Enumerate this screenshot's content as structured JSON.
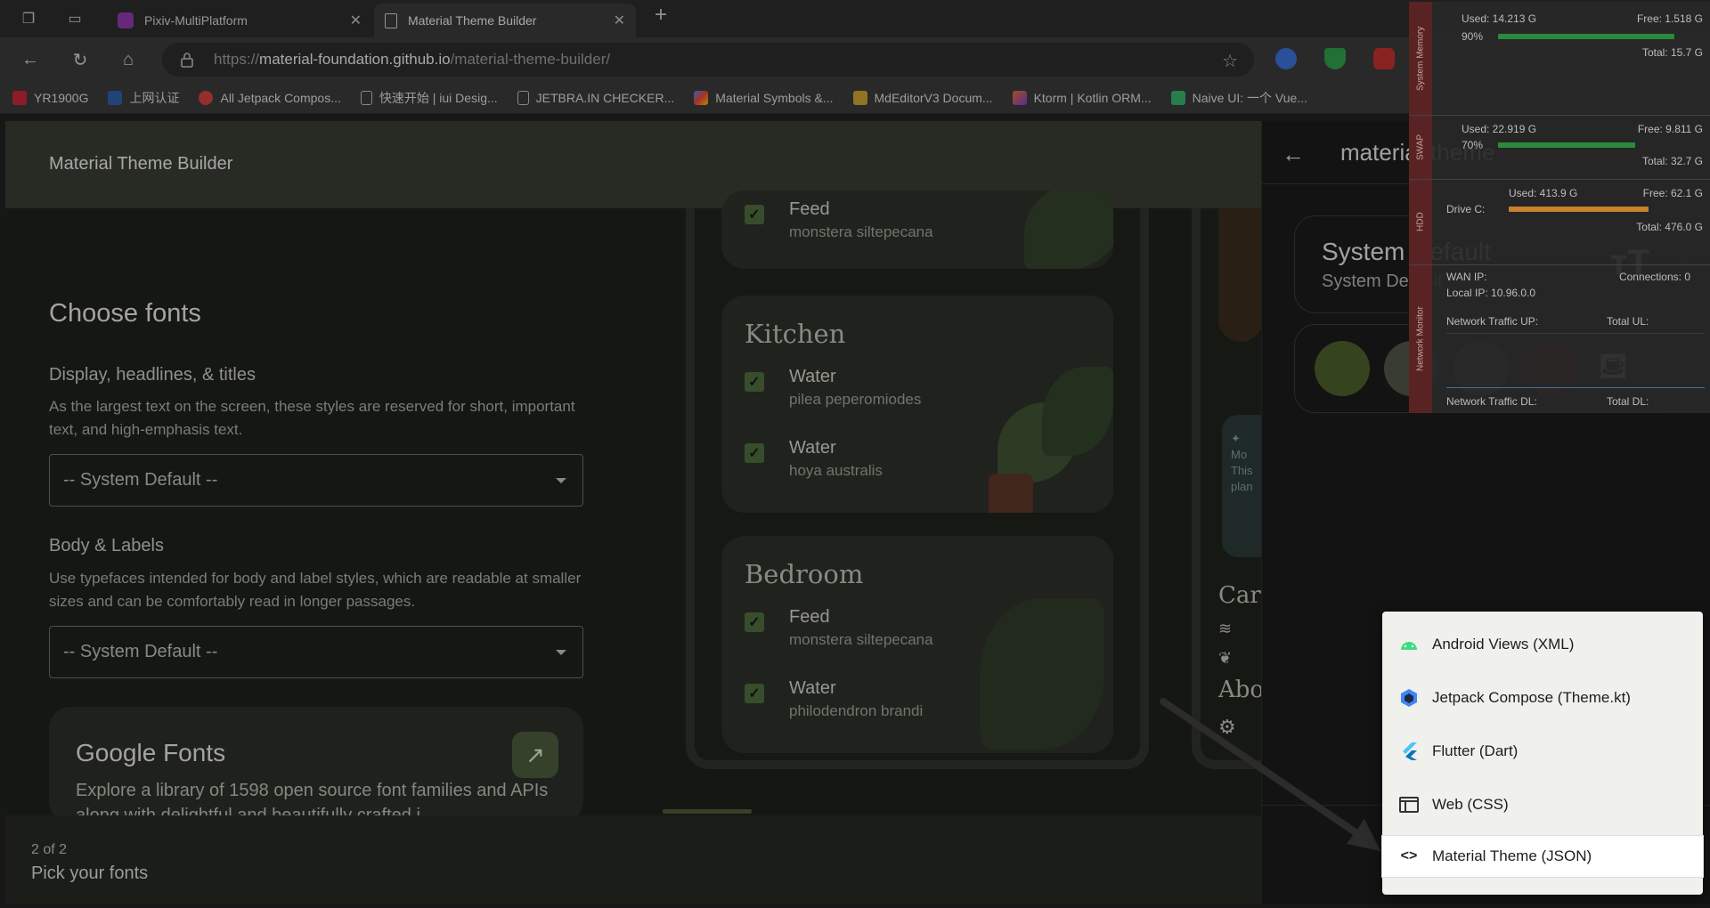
{
  "browser": {
    "tabs": [
      {
        "title": "Pixiv-MultiPlatform",
        "favicon_color": "#8e3aa8"
      },
      {
        "title": "Material Theme Builder",
        "active": true
      }
    ],
    "url_prefix": "https://",
    "url_host": "material-foundation.github.io",
    "url_path": "/material-theme-builder/",
    "bookmarks": [
      {
        "label": "YR1900G",
        "icon_color": "#c7283a"
      },
      {
        "label": "上网认证",
        "icon_color": "#2f5fa8"
      },
      {
        "label": "All Jetpack Compos...",
        "icon_color": "#d24040"
      },
      {
        "label": "快速开始 | iui Desig...",
        "icon_color": "#aaaaaa"
      },
      {
        "label": "JETBRA.IN CHECKER...",
        "icon_color": "#aaaaaa"
      },
      {
        "label": "Material Symbols &...",
        "icon_color": "#4285f4"
      },
      {
        "label": "MdEditorV3 Docum...",
        "icon_color": "#c9a030"
      },
      {
        "label": "Ktorm | Kotlin ORM...",
        "icon_color": "#e07020"
      },
      {
        "label": "Naive UI: 一个 Vue...",
        "icon_color": "#36ad6a"
      }
    ]
  },
  "app": {
    "title": "Material Theme Builder",
    "heading": "Choose fonts",
    "display_section": {
      "title": "Display, headlines, & titles",
      "description": "As the largest text on the screen, these styles are reserved for short, important text, and high-emphasis text.",
      "select_value": "-- System Default --"
    },
    "body_section": {
      "title": "Body & Labels",
      "description": "Use typefaces intended for body and label styles, which are readable at smaller sizes and can be comfortably read in longer passages.",
      "select_value": "-- System Default --"
    },
    "google_fonts": {
      "title": "Google Fonts",
      "description": "Explore a library of 1598 open source font families and APIs along with delightful and beautifully crafted i..."
    },
    "stepper": {
      "count": "2 of 2",
      "label": "Pick your fonts"
    }
  },
  "preview": {
    "top_task": {
      "name": "Feed",
      "plant": "monstera siltepecana"
    },
    "rooms": [
      {
        "name": "Kitchen",
        "tasks": [
          {
            "name": "Water",
            "plant": "pilea peperomiodes"
          },
          {
            "name": "Water",
            "plant": "hoya australis"
          }
        ]
      },
      {
        "name": "Bedroom",
        "tasks": [
          {
            "name": "Feed",
            "plant": "monstera siltepecana"
          },
          {
            "name": "Water",
            "plant": "philodendron brandi"
          }
        ]
      }
    ],
    "side_texts": {
      "mo": "Mo",
      "this": "This",
      "plan": "plan",
      "car": "Car",
      "abo": "Abo"
    }
  },
  "export_panel": {
    "title": "material-theme",
    "font_card": {
      "title": "System Default",
      "subtitle": "System Default"
    },
    "swatches": [
      "#4a5e2a",
      "#505447",
      "#3b4a3e",
      "#6b1f1f",
      "#303030"
    ],
    "menu": [
      {
        "label": "Android Views (XML)",
        "icon": "android-icon"
      },
      {
        "label": "Jetpack Compose (Theme.kt)",
        "icon": "compose-icon"
      },
      {
        "label": "Flutter (Dart)",
        "icon": "flutter-icon"
      },
      {
        "label": "Web (CSS)",
        "icon": "web-icon"
      },
      {
        "label": "Material Theme (JSON)",
        "icon": "code-icon",
        "highlighted": true
      }
    ]
  },
  "system_monitor": {
    "memory": {
      "used": "Used: 14.213 G",
      "free": "Free: 1.518 G",
      "percent": "90%",
      "total": "Total: 15.7 G",
      "fill": 0.9
    },
    "swap": {
      "used": "Used: 22.919 G",
      "free": "Free: 9.811 G",
      "percent": "70%",
      "total": "Total: 32.7 G",
      "fill": 0.7
    },
    "hdd": {
      "used": "Used: 413.9 G",
      "free": "Free: 62.1 G",
      "drive": "Drive C:",
      "total": "Total: 476.0 G",
      "fill": 0.87
    },
    "network": {
      "wan": "WAN IP:",
      "connections": "Connections: 0",
      "local": "Local IP: 10.96.0.0",
      "up": "Network Traffic UP:",
      "total_ul": "Total UL:",
      "dl": "Network Traffic DL:",
      "total_dl": "Total DL:"
    },
    "tabs": [
      "System Memory",
      "SWAP",
      "HDD",
      "Network Monitor"
    ]
  }
}
